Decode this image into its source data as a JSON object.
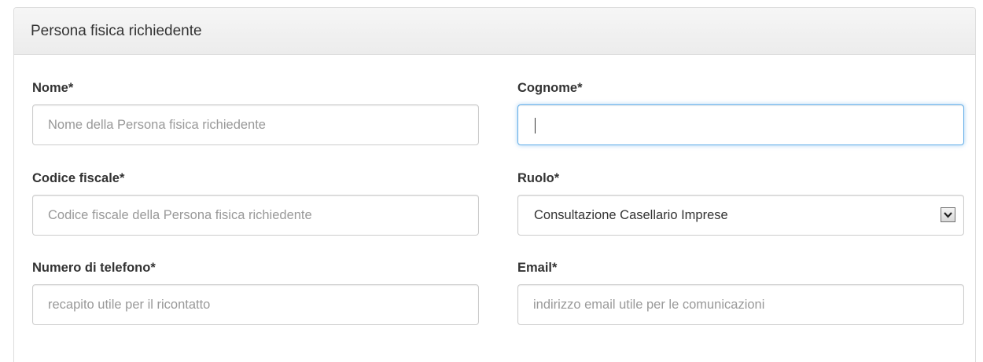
{
  "panel": {
    "title": "Persona fisica richiedente"
  },
  "fields": {
    "nome": {
      "label": "Nome*",
      "placeholder": "Nome della Persona fisica richiedente",
      "value": ""
    },
    "cognome": {
      "label": "Cognome*",
      "placeholder": "",
      "value": "",
      "focused": true
    },
    "codice_fiscale": {
      "label": "Codice fiscale*",
      "placeholder": "Codice fiscale della Persona fisica richiedente",
      "value": ""
    },
    "ruolo": {
      "label": "Ruolo*",
      "selected": "Consultazione Casellario Imprese",
      "icon": "chevron-down-icon"
    },
    "telefono": {
      "label": "Numero di telefono*",
      "placeholder": "recapito utile per il ricontatto",
      "value": ""
    },
    "email": {
      "label": "Email*",
      "placeholder": "indirizzo email utile per le comunicazioni",
      "value": ""
    }
  },
  "colors": {
    "focus_border": "#66afe9",
    "input_border": "#cccccc",
    "placeholder": "#999999",
    "label": "#333333"
  }
}
